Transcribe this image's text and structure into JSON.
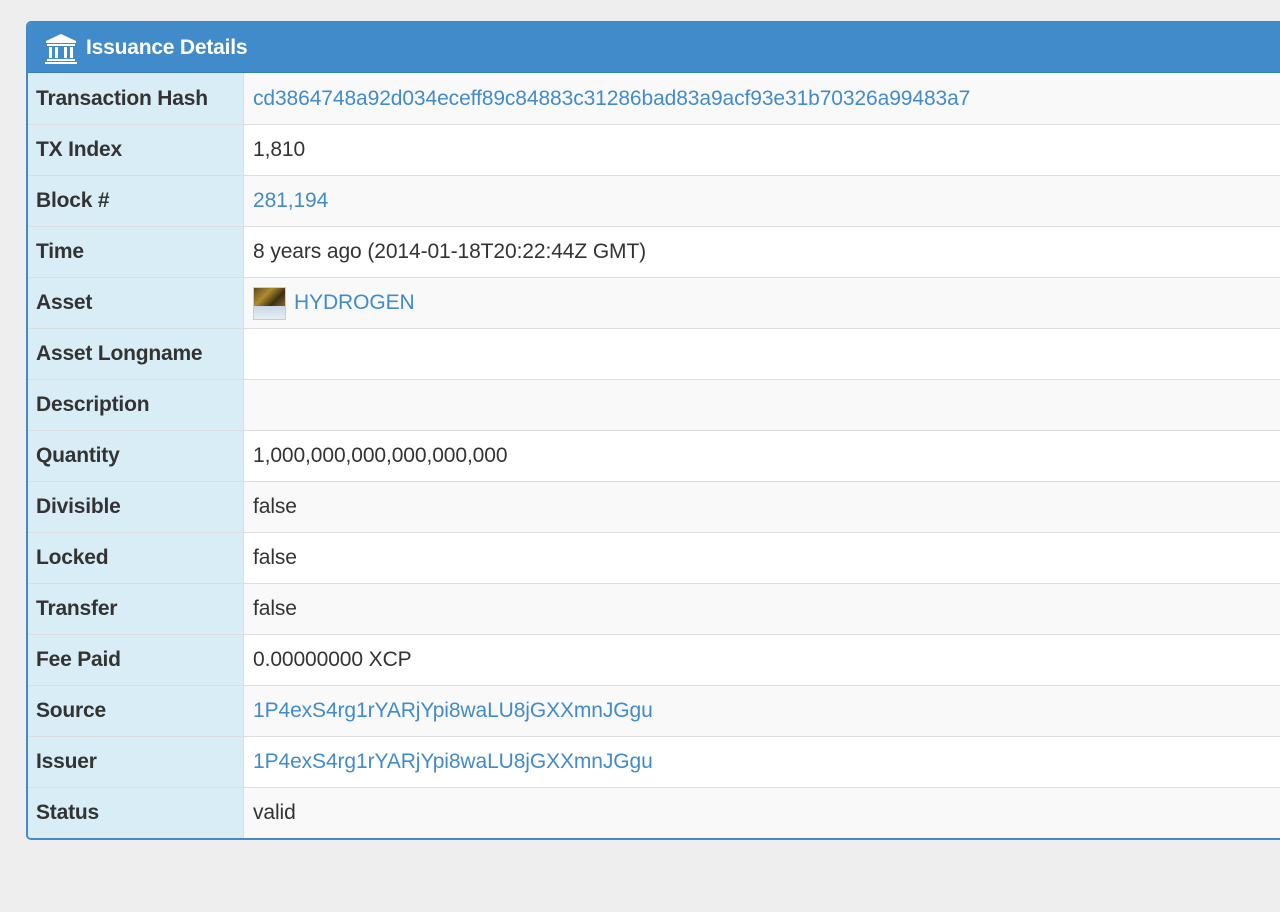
{
  "panel": {
    "title": "Issuance Details",
    "icon": "bank-icon"
  },
  "rows": [
    {
      "key": "transaction_hash",
      "label": "Transaction Hash",
      "value": "cd3864748a92d034eceff89c84883c31286bad83a9acf93e31b70326a99483a7",
      "link": true
    },
    {
      "key": "tx_index",
      "label": "TX Index",
      "value": "1,810",
      "link": false
    },
    {
      "key": "block",
      "label": "Block #",
      "value": "281,194",
      "link": true
    },
    {
      "key": "time",
      "label": "Time",
      "value": "8 years ago (2014-01-18T20:22:44Z GMT)",
      "link": false
    },
    {
      "key": "asset",
      "label": "Asset",
      "value": "HYDROGEN",
      "link": true,
      "icon": "asset-thumbnail"
    },
    {
      "key": "asset_longname",
      "label": "Asset Longname",
      "value": "",
      "link": false
    },
    {
      "key": "description",
      "label": "Description",
      "value": "",
      "link": false
    },
    {
      "key": "quantity",
      "label": "Quantity",
      "value": "1,000,000,000,000,000,000",
      "link": false
    },
    {
      "key": "divisible",
      "label": "Divisible",
      "value": "false",
      "link": false
    },
    {
      "key": "locked",
      "label": "Locked",
      "value": "false",
      "link": false
    },
    {
      "key": "transfer",
      "label": "Transfer",
      "value": "false",
      "link": false
    },
    {
      "key": "fee_paid",
      "label": "Fee Paid",
      "value": "0.00000000 XCP",
      "link": false
    },
    {
      "key": "source",
      "label": "Source",
      "value": "1P4exS4rg1rYARjYpi8waLU8jGXXmnJGgu",
      "link": true
    },
    {
      "key": "issuer",
      "label": "Issuer",
      "value": "1P4exS4rg1rYARjYpi8waLU8jGXXmnJGgu",
      "link": true
    },
    {
      "key": "status",
      "label": "Status",
      "value": "valid",
      "link": false
    }
  ],
  "colors": {
    "heading_bg": "#428bca",
    "label_bg": "#d9edf7",
    "link": "#428bca",
    "page_bg": "#eeeeee"
  }
}
